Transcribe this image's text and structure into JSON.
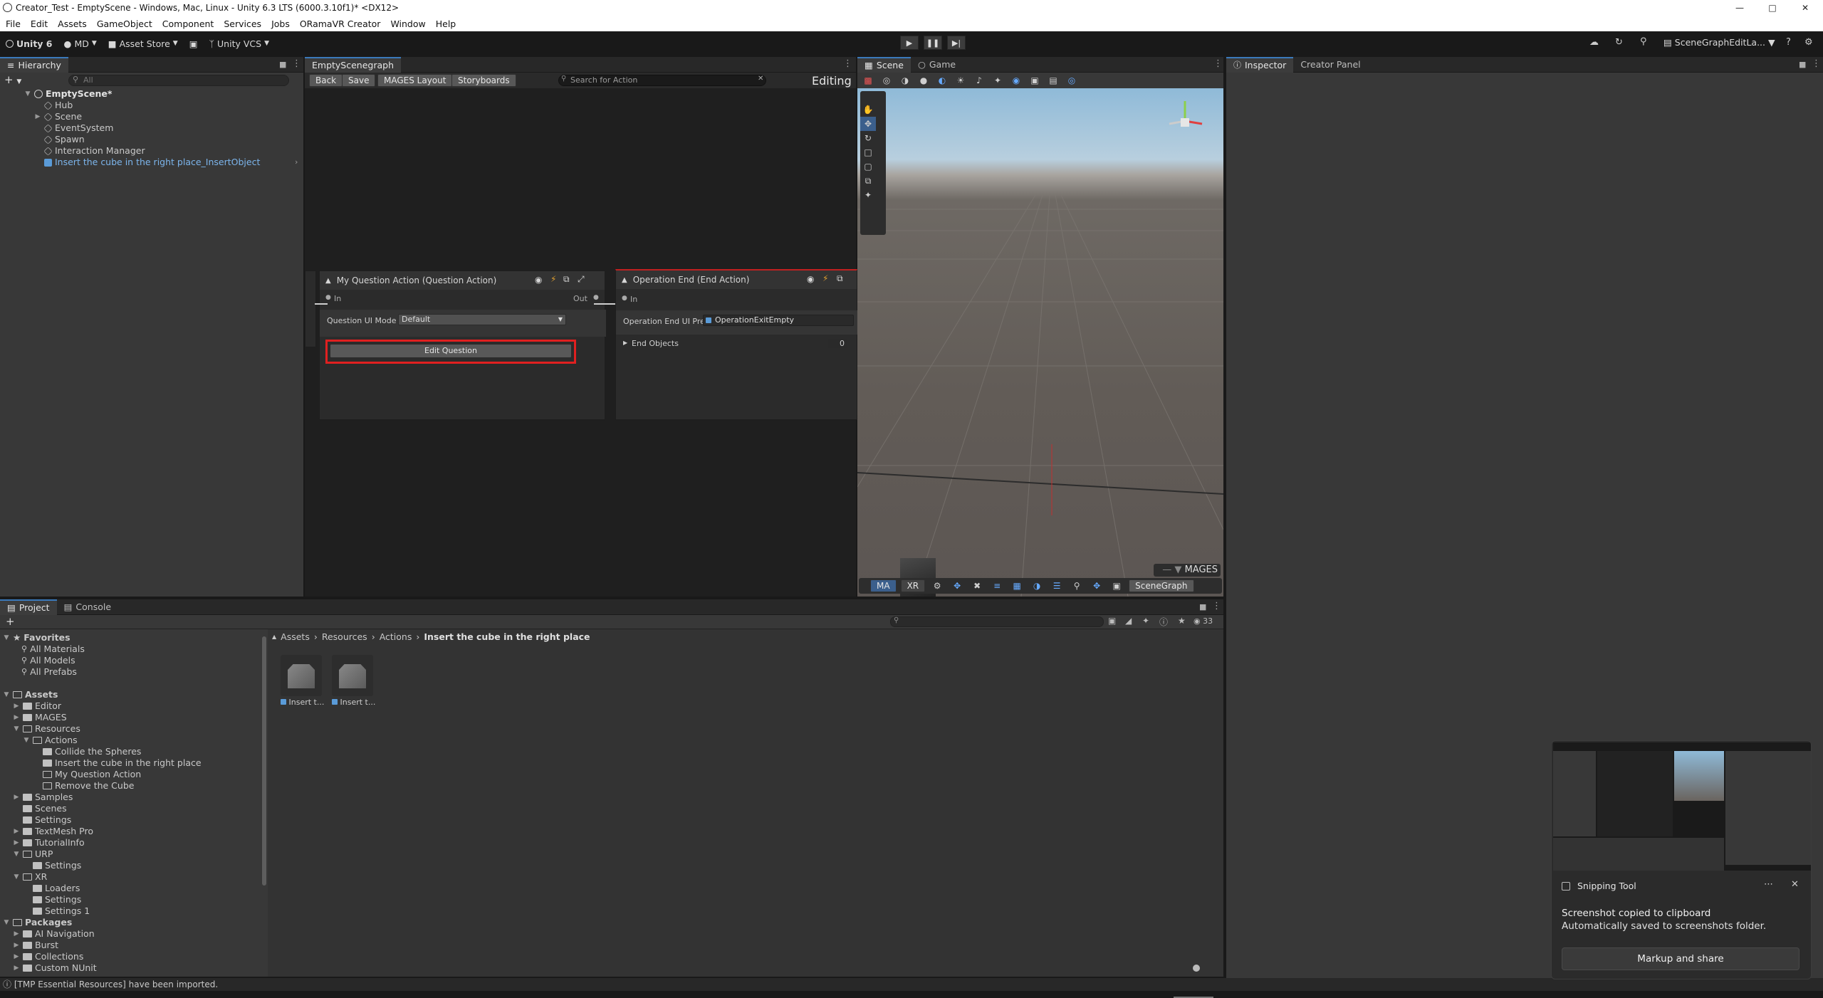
{
  "window": {
    "title": "Creator_Test - EmptyScene - Windows, Mac, Linux - Unity 6.3 LTS (6000.3.10f1)* <DX12>"
  },
  "menu": [
    "File",
    "Edit",
    "Assets",
    "GameObject",
    "Component",
    "Services",
    "Jobs",
    "ORamaVR Creator",
    "Window",
    "Help"
  ],
  "toolbar": {
    "unity": "Unity 6",
    "account": "MD",
    "asset_store": "Asset Store",
    "vcs": "Unity VCS",
    "layout": "SceneGraphEditLa..."
  },
  "hierarchy": {
    "tab": "Hierarchy",
    "search_placeholder": "All",
    "scene": "EmptyScene*",
    "items": [
      "Hub",
      "Scene",
      "EventSystem",
      "Spawn",
      "Interaction Manager",
      "Insert the cube in the right place_InsertObject"
    ]
  },
  "scenegraph": {
    "tab": "EmptyScenegraph",
    "back": "Back",
    "save": "Save",
    "mages_layout": "MAGES Layout",
    "storyboards": "Storyboards",
    "search_placeholder": "Search for Action",
    "mode": "Editing",
    "node1": {
      "title": "My Question Action (Question Action)",
      "port_in": "In",
      "port_out": "Out",
      "field_label": "Question UI Mode",
      "field_value": "Default",
      "button": "Edit Question"
    },
    "node2": {
      "title": "Operation End (End Action)",
      "port_in": "In",
      "field_label": "Operation End UI Prefab",
      "field_value": "OperationExitEmpty",
      "foldout": "End Objects",
      "foldout_count": "0"
    }
  },
  "scene": {
    "tab_scene": "Scene",
    "tab_game": "Game",
    "overlay_title": "MAGES",
    "overlay_buttons": [
      "MA",
      "XR"
    ],
    "scenegraph_btn": "SceneGraph"
  },
  "inspector": {
    "tab": "Inspector",
    "tab2": "Creator Panel"
  },
  "project": {
    "tab": "Project",
    "tab2": "Console",
    "count": "33",
    "favorites": {
      "label": "Favorites",
      "items": [
        "All Materials",
        "All Models",
        "All Prefabs"
      ]
    },
    "assets_label": "Assets",
    "tree": [
      {
        "label": "Editor",
        "depth": 1,
        "arrow": "▶",
        "open": false
      },
      {
        "label": "MAGES",
        "depth": 1,
        "arrow": "▶",
        "open": false
      },
      {
        "label": "Resources",
        "depth": 1,
        "arrow": "▼",
        "open": true
      },
      {
        "label": "Actions",
        "depth": 2,
        "arrow": "▼",
        "open": true
      },
      {
        "label": "Collide the Spheres",
        "depth": 3,
        "arrow": "",
        "open": false
      },
      {
        "label": "Insert the cube in the right place",
        "depth": 3,
        "arrow": "",
        "open": false
      },
      {
        "label": "My Question Action",
        "depth": 3,
        "arrow": "",
        "open": true
      },
      {
        "label": "Remove the Cube",
        "depth": 3,
        "arrow": "",
        "open": true
      },
      {
        "label": "Samples",
        "depth": 1,
        "arrow": "▶",
        "open": false
      },
      {
        "label": "Scenes",
        "depth": 1,
        "arrow": "",
        "open": false
      },
      {
        "label": "Settings",
        "depth": 1,
        "arrow": "",
        "open": false
      },
      {
        "label": "TextMesh Pro",
        "depth": 1,
        "arrow": "▶",
        "open": false
      },
      {
        "label": "TutorialInfo",
        "depth": 1,
        "arrow": "▶",
        "open": false
      },
      {
        "label": "URP",
        "depth": 1,
        "arrow": "▼",
        "open": true
      },
      {
        "label": "Settings",
        "depth": 2,
        "arrow": "",
        "open": false
      },
      {
        "label": "XR",
        "depth": 1,
        "arrow": "▼",
        "open": true
      },
      {
        "label": "Loaders",
        "depth": 2,
        "arrow": "",
        "open": false
      },
      {
        "label": "Settings",
        "depth": 2,
        "arrow": "",
        "open": false
      },
      {
        "label": "Settings 1",
        "depth": 2,
        "arrow": "",
        "open": false
      }
    ],
    "packages_label": "Packages",
    "packages": [
      "AI Navigation",
      "Burst",
      "Collections",
      "Custom NUnit"
    ],
    "breadcrumb": [
      "Assets",
      "Resources",
      "Actions",
      "Insert the cube in the right place"
    ],
    "files": [
      "Insert t...",
      "Insert t..."
    ]
  },
  "status": "[TMP Essential Resources] have been imported.",
  "snipping": {
    "app": "Snipping Tool",
    "line1": "Screenshot copied to clipboard",
    "line2": "Automatically saved to screenshots folder.",
    "button": "Markup and share"
  }
}
